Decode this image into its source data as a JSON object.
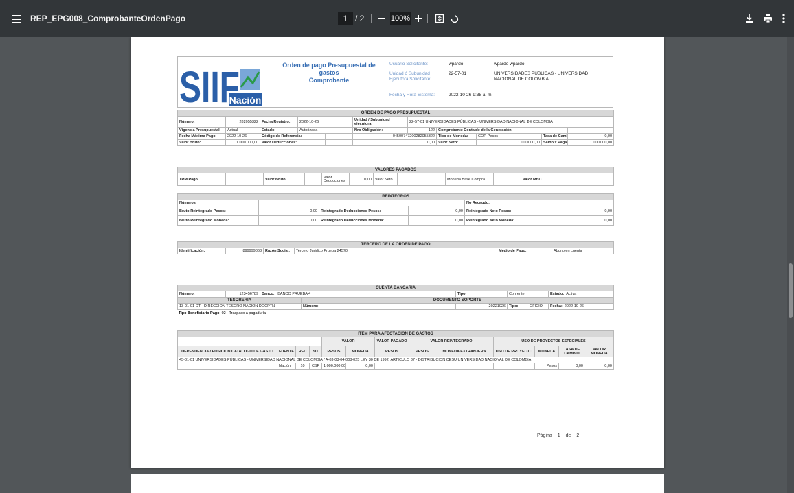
{
  "toolbar": {
    "filename": "REP_EPG008_ComprobanteOrdenPago",
    "current_page": "1",
    "total": "/ 2",
    "zoom": "100%",
    "icons": [
      "menu-icon",
      "zoom-out-icon",
      "zoom-in-icon",
      "fit-page-icon",
      "rotate-icon",
      "download-icon",
      "print-icon",
      "more-icon"
    ]
  },
  "header": {
    "title": "Orden de pago Presupuestal  de gastos",
    "subtitle": "Comprobante",
    "user_label": "Usuario Solicitante:",
    "user_code": "wpardo",
    "user_name": "wpardo  wpardo",
    "unit_label": "Unidad ó Subunidad Ejecutora Solicitante:",
    "unit_code": "22-57-01",
    "unit_name": "UNIVERSIDADES PÚBLICAS - UNIVERSIDAD NACIONAL DE COLOMBIA",
    "date_label": "Fecha y Hora Sistema:",
    "date_value": "2022-10-26-9:38 a. m.",
    "logo_text": "SIIF",
    "logo_sub": "Nación"
  },
  "orden": {
    "title": "ORDEN DE PAGO PRESUPUESTAL",
    "numero_l": "Número:",
    "numero": "282055322",
    "freg_l": "Fecha Registro:",
    "freg": "2022-10-26",
    "unidad_l": "Unidad / Subunidad ejecutora:",
    "unidad": "22-57-01  UNIVERSIDADES PÚBLICAS - UNIVERSIDAD NACIONAL DE COLOMBIA",
    "vig_l": "Vigencia Presupuestal",
    "vig": "Actual",
    "estado_l": "Estado:",
    "estado": "Autorizada",
    "nro_obl_l": "Nro Obligación:",
    "nro_obl": "122",
    "comp_l": "Comprobante Contable de la Generación:",
    "fmax_l": "Fecha Máxima Pago:",
    "fmax": "2022-10-26",
    "cref_l": "Código de Referencia:",
    "cref": "04500747200282055322",
    "tmon_l": "Tipo de Moneda:",
    "tmon": "COP-Pesos",
    "tcam_l": "Tasa de Cambio:",
    "tcam": "0,00",
    "vbruto_l": "Valor Bruto:",
    "vbruto": "1.000.000,00",
    "vded_l": "Valor Deducciones:",
    "vded": "0,00",
    "vneto_l": "Valor Neto:",
    "vneto": "1.000.000,00",
    "saldo_l": "Saldo x Pagar:",
    "saldo": "1.000.000,00"
  },
  "pagados": {
    "title": "VALORES PAGADOS",
    "trm": "TRM Pago",
    "vbruto": "Valor Bruto",
    "vded": "Valor Deducciones",
    "vded_val": "0,00",
    "vneto": "Valor Neto",
    "mbc": "Moneda Base Compra",
    "vmbc": "Valor MBC"
  },
  "reintegros": {
    "title": "REINTEGROS",
    "numeros": "Números",
    "norec": "No Recaudo:",
    "brp": "Bruto Reintegrado Pesos:",
    "brp_v": "0,00",
    "rdp": "Reintegrado Deducciones Pesos:",
    "rdp_v": "0,00",
    "rnp": "Reintegrado Neto Pesos:",
    "rnp_v": "0,00",
    "brm": "Bruto Reintegrado Moneda:",
    "brm_v": "0,00",
    "rdm": "Reintegrado Deducciones Moneda:",
    "rdm_v": "0,00",
    "rnm": "Reintegrado Neto Moneda:",
    "rnm_v": "0,00"
  },
  "tercero": {
    "title": "TERCERO DE LA ORDEN DE PAGO",
    "id_l": "Identificación:",
    "id": "899999063",
    "rs_l": "Razón Social:",
    "rs": "Tercero Juridico Prueba 24570",
    "mp_l": "Medio de Pago:",
    "mp": "Abono en cuenta"
  },
  "cuenta": {
    "title": "CUENTA BANCARIA",
    "num_l": "Número:",
    "num": "123456789",
    "banco_l": "Banco:",
    "banco": "BANCO PRUEBA 4",
    "tipo_l": "Tipo:",
    "tipo": "Corriente",
    "estado_l": "Estado:",
    "estado": "Activa"
  },
  "tesoreria": {
    "title": "TESORERIA",
    "value": "13-01-01-DT - DIRECCION TESORO NACION DGCPTN"
  },
  "soporte": {
    "title": "DOCUMENTO SOPORTE",
    "num_l": "Número:",
    "num": "20221026",
    "tipo_l": "Tipo:",
    "tipo": "OFICIO",
    "fecha_l": "Fecha:",
    "fecha": "2022-10-26"
  },
  "beneficiario": {
    "label": "Tipo Beneficiario Pago",
    "value": "02 - Traspaso a pagaduría"
  },
  "items": {
    "title": "ITEM PARA AFECTACION DE GASTOS",
    "valor": "VALOR",
    "valor_pagado": "VALOR PAGADO",
    "valor_reint": "VALOR REINTEGRADO",
    "uso": "USO DE PROYECTOS ESPECIALES",
    "dep": "DEPENDENCIA / POSICION CATALOGO DE GASTO",
    "fuente": "FUENTE",
    "rec": "REC",
    "sit": "SIT",
    "pesos": "PESOS",
    "moneda": "MONEDA",
    "pesos2": "PESOS",
    "pesos3": "PESOS",
    "mext": "MONEDA EXTRANJERA",
    "usop": "USO DE PROYECTO",
    "moneda2": "MONEDA",
    "tasa": "TASA DE CAMBIO",
    "vmon": "VALOR MONEDA",
    "desc": "45-01-01  UNIVERSIDADES PÚBLICAS - UNIVERSIDAD NACIONAL DE COLOMBIA  /  A-03-03-04-008-025  LEY 30 DE 1992, ARTICULO 87 - DISTRIBUCION CESU UNIVERSIDAD NACIONAL DE COLOMBIA",
    "r_fuente": "Nación",
    "r_rec": "10",
    "r_sit": "CSF",
    "r_pesos": "1.000.000,00",
    "r_moneda": "0,00",
    "r_mon2": "Pesos",
    "r_tasa": "0,00",
    "r_vmon": "0,00"
  },
  "footer": {
    "pagina": "Página",
    "actual": "1",
    "de": "de",
    "total": "2"
  }
}
